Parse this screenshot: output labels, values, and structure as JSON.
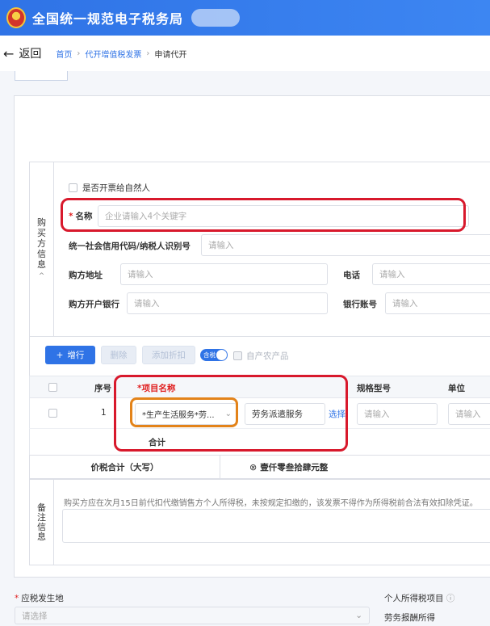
{
  "header": {
    "title": "全国统一规范电子税务局"
  },
  "nav": {
    "back_label": "返回",
    "breadcrumb": [
      "首页",
      "代开增值税发票",
      "申请代开"
    ]
  },
  "buyer": {
    "section_title": [
      "购",
      "买",
      "方",
      "信",
      "息"
    ],
    "natural_person_label": "是否开票给自然人",
    "name_label": "名称",
    "name_placeholder": "企业请输入4个关键字",
    "credit_code_label": "统一社会信用代码/纳税人识别号",
    "credit_code_placeholder": "请输入",
    "address_label": "购方地址",
    "address_placeholder": "请输入",
    "phone_label": "电话",
    "phone_placeholder": "请输入",
    "bank_label": "购方开户银行",
    "bank_placeholder": "请输入",
    "account_label": "银行账号",
    "account_placeholder": "请输入"
  },
  "toolbar": {
    "add_row": "增行",
    "delete": "删除",
    "add_discount": "添加折扣",
    "tax_incl_toggle": "含税",
    "farm_products": "自产农产品"
  },
  "table": {
    "headers": {
      "seq": "序号",
      "item_name": "*项目名称",
      "spec": "规格型号",
      "unit": "单位"
    },
    "rows": [
      {
        "seq": "1",
        "item_select": "*生产生活服务*劳...",
        "item_input": "劳务派遣服务",
        "choose": "选择",
        "spec_placeholder": "请输入",
        "unit_placeholder": "请输入"
      }
    ],
    "total_label": "合计"
  },
  "sum": {
    "label": "价税合计（大写）",
    "value": "壹仟零叁拾肆元整"
  },
  "remark": {
    "section_title": [
      "备",
      "注",
      "信",
      "息"
    ],
    "hint": "购买方应在次月15日前代扣代缴销售方个人所得税，未按规定扣缴的，该发票不得作为所得税前合法有效扣除凭证。"
  },
  "bottom": {
    "tax_location_label": "应税发生地",
    "tax_location_placeholder": "请选择",
    "income_item_label": "个人所得税项目",
    "income_item_value": "劳务报酬所得"
  },
  "colors": {
    "primary": "#2f73e6",
    "highlight_red": "#d8192c",
    "highlight_orange": "#e3831a"
  }
}
